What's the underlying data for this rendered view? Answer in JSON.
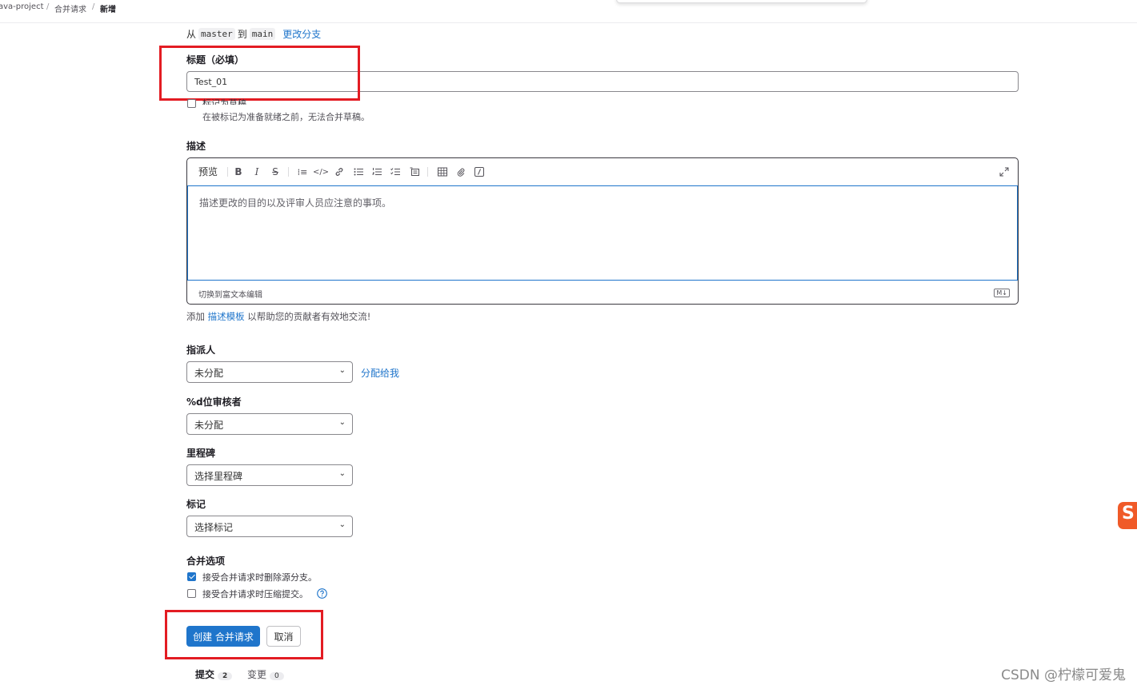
{
  "breadcrumb": {
    "project": "ava-project",
    "section": "合并请求",
    "current": "新增"
  },
  "branch": {
    "from_label": "从",
    "source": "master",
    "to_label": "到",
    "target": "main",
    "change_link": "更改分支"
  },
  "title_field": {
    "label": "标题（必填）",
    "value": "Test_01"
  },
  "draft": {
    "label": "标记为草稿",
    "help": "在被标记为准备就绪之前，无法合并草稿。",
    "checked": false
  },
  "description": {
    "label": "描述",
    "preview_tab": "预览",
    "placeholder": "描述更改的目的以及评审人员应注意的事项。",
    "rich_text_toggle": "切换到富文本编辑",
    "markdown_badge": "M↓",
    "toolbar_icons": [
      "bold-icon",
      "italic-icon",
      "strikethrough-icon",
      "quote-icon",
      "code-icon",
      "link-icon",
      "bullet-list-icon",
      "numbered-list-icon",
      "task-list-icon",
      "collapsible-icon",
      "table-icon",
      "attach-icon",
      "slash-command-icon",
      "fullscreen-icon"
    ],
    "template_hint_prefix": "添加 ",
    "template_link": "描述模板",
    "template_hint_suffix": " 以帮助您的贡献者有效地交流!"
  },
  "assignee": {
    "label": "指派人",
    "value": "未分配",
    "assign_to_me": "分配给我"
  },
  "reviewers": {
    "label": "%d位审核者",
    "value": "未分配"
  },
  "milestone": {
    "label": "里程碑",
    "value": "选择里程碑"
  },
  "labels": {
    "label": "标记",
    "value": "选择标记"
  },
  "merge_options": {
    "label": "合并选项",
    "delete_source": "接受合并请求时删除源分支。",
    "delete_source_checked": true,
    "squash": "接受合并请求时压缩提交。",
    "squash_checked": false
  },
  "actions": {
    "create": "创建 合并请求",
    "cancel": "取消"
  },
  "tabs": {
    "commits_label": "提交",
    "commits_count": "2",
    "changes_label": "变更",
    "changes_count": "0"
  },
  "watermark": "CSDN @柠檬可爱鬼",
  "colors": {
    "primary": "#1f75cb",
    "annotation_red": "#e31c23",
    "logo_orange": "#f05a28"
  }
}
